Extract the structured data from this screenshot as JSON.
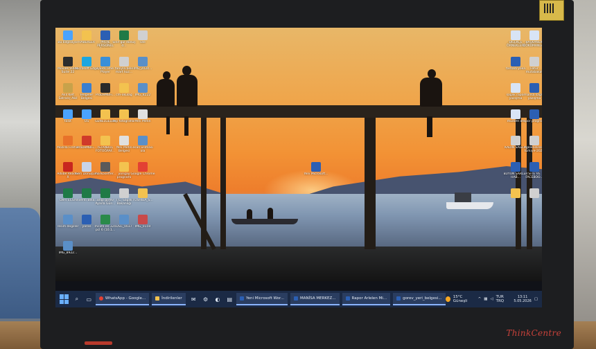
{
  "colors": {
    "taskbar": "#1b2a45",
    "accent": "#8ab4ff",
    "sticker": "#d8b94a",
    "brand_red": "#c8423a"
  },
  "monitor": {
    "brand": "ThinkCentre"
  },
  "desktop": {
    "left_icons": [
      {
        "label": "Bu bilgisayar",
        "icon": "computer-icon",
        "color": "#4aa3ff"
      },
      {
        "label": "HABERLER",
        "icon": "folder-icon",
        "color": "#f3c24f"
      },
      {
        "label": "PROJE PERSONEL Belgesi",
        "icon": "word-doc-icon",
        "color": "#2b5fb3"
      },
      {
        "label": "Sınıf gül dönüş d...",
        "icon": "excel-doc-icon",
        "color": "#1f7a46"
      },
      {
        "label": "İzle",
        "icon": "file-icon",
        "color": "#d0d0d0"
      },
      {
        "label": "Movies Video Suite 22",
        "icon": "video-app-icon",
        "color": "#2d2d2d"
      },
      {
        "label": "Microsoft Edge",
        "icon": "edge-icon",
        "color": "#1da6e0"
      },
      {
        "label": "QuickTime Player",
        "icon": "quicktime-icon",
        "color": "#3a8fd8"
      },
      {
        "label": "tanıyla bele mart kuz...",
        "icon": "file-icon",
        "color": "#d0d0d0"
      },
      {
        "label": "IMG_2024...",
        "icon": "image-icon",
        "color": "#5a8fc8"
      },
      {
        "label": "Akıl Kelt Satranç Akıl",
        "icon": "game-icon",
        "color": "#c8a24a"
      },
      {
        "label": "Belgeler Belgesi",
        "icon": "folder-icon",
        "color": "#3a7fd0"
      },
      {
        "label": "ProDeMBFi...",
        "icon": "app-icon",
        "color": "#2a2a2a"
      },
      {
        "label": "cm-okulag",
        "icon": "folder-icon",
        "color": "#f3c24f"
      },
      {
        "label": "IMG_8222",
        "icon": "image-icon",
        "color": "#5a8fc8"
      },
      {
        "label": "tasit",
        "icon": "file-icon",
        "color": "#4aa3ff"
      },
      {
        "label": "OS",
        "icon": "file-icon",
        "color": "#4aa3ff"
      },
      {
        "label": "GENELGELER",
        "icon": "folder-icon",
        "color": "#f3c24f"
      },
      {
        "label": "tep fotoğraflar",
        "icon": "folder-icon",
        "color": "#f3c24f"
      },
      {
        "label": "Yeni Metin",
        "icon": "text-doc-icon",
        "color": "#e0e0e0"
      },
      {
        "label": "Mozilla Firefox",
        "icon": "firefox-icon",
        "color": "#e8722a"
      },
      {
        "label": "ProDeMBFi...",
        "icon": "app-icon",
        "color": "#d03a2a"
      },
      {
        "label": "İSTANBUL FOTOĞRAF...",
        "icon": "folder-icon",
        "color": "#f3c24f"
      },
      {
        "label": "Yeni Metin Belgesi",
        "icon": "text-doc-icon",
        "color": "#e0e0e0"
      },
      {
        "label": "esan üslmasi ola",
        "icon": "image-icon",
        "color": "#5a8fc8"
      },
      {
        "label": "Adobe Reader X",
        "icon": "pdf-icon",
        "color": "#c8261f"
      },
      {
        "label": "Geri Dönüşüm",
        "icon": "recycle-bin-icon",
        "color": "#c8d4e8"
      },
      {
        "label": "markoseffer...",
        "icon": "image-icon",
        "color": "#5a5a5a"
      },
      {
        "label": "yorigay programı",
        "icon": "folder-icon",
        "color": "#f3c24f"
      },
      {
        "label": "Google Chrome",
        "icon": "chrome-icon",
        "color": "#e34133"
      },
      {
        "label": "Ders ECSA",
        "icon": "excel-doc-icon",
        "color": "#1f7a46"
      },
      {
        "label": "İnventi Bela...",
        "icon": "excel-doc-icon",
        "color": "#1f7a46"
      },
      {
        "label": "Bİlgi görev Ayarla Gün...",
        "icon": "excel-doc-icon",
        "color": "#1f7a46"
      },
      {
        "label": "T.C. Sağlık Bakanlığı",
        "icon": "file-icon",
        "color": "#d0d0d0"
      },
      {
        "label": "TOSHIBA_S...",
        "icon": "folder-icon",
        "color": "#f3c24f"
      },
      {
        "label": "resim değiller",
        "icon": "image-icon",
        "color": "#5a8fc8"
      },
      {
        "label": "yaran",
        "icon": "word-doc-icon",
        "color": "#2b5fb3"
      },
      {
        "label": "mcafe en 320 pcl 6 (10.1...",
        "icon": "app-icon",
        "color": "#2a8a4a"
      },
      {
        "label": "DSC_0037",
        "icon": "image-icon",
        "color": "#5a8fc8"
      },
      {
        "label": "IMG_0159",
        "icon": "image-icon",
        "color": "#c84a4a"
      },
      {
        "label": "IMG_8922...",
        "icon": "image-icon",
        "color": "#5a8fc8"
      }
    ],
    "right_icons": [
      {
        "label": "DİLEKÇE ÖRNEKLERİ",
        "icon": "word-doc-icon",
        "color": "#d8e4f5"
      },
      {
        "label": "BAŞKANLIK DÖKÜMANLAR",
        "icon": "word-doc-icon",
        "color": "#d8e4f5"
      },
      {
        "label": "tamadi yoka",
        "icon": "word-doc-icon",
        "color": "#2b5fb3"
      },
      {
        "label": "Fatur mutabakat",
        "icon": "file-icon",
        "color": "#d0d0d0"
      },
      {
        "label": "sağlık rapor yazışma",
        "icon": "word-doc-icon",
        "color": "#d8e4f5"
      },
      {
        "label": "mansa sağlık yazışma",
        "icon": "word-doc-icon",
        "color": "#2b5fb3"
      },
      {
        "label": "mudafe alt",
        "icon": "word-doc-icon",
        "color": "#d8e4f5"
      },
      {
        "label": "spor program",
        "icon": "word-doc-icon",
        "color": "#2b5fb3"
      },
      {
        "label": "KADIN SAĞLIK",
        "icon": "file-icon",
        "color": "#d0d0d0"
      },
      {
        "label": "geleneksel türkiye-2026",
        "icon": "file-icon",
        "color": "#d0d0d0"
      },
      {
        "label": "BÜYÜN ŞARLER HAB...",
        "icon": "word-doc-icon",
        "color": "#2b5fb3"
      },
      {
        "label": "SİTE VE FACEBOO...",
        "icon": "word-doc-icon",
        "color": "#2b5fb3"
      },
      {
        "label": "",
        "icon": "file-icon",
        "color": "#f3c24f"
      },
      {
        "label": "",
        "icon": "file-icon",
        "color": "#d0d0d0"
      }
    ],
    "center_icon": {
      "label": "Yeni Microsoft...",
      "icon": "word-doc-icon",
      "color": "#2b5fb3"
    }
  },
  "taskbar": {
    "apps": [
      {
        "label": "WhatsApp - Google...",
        "icon": "chrome-icon",
        "color": "#e34133"
      },
      {
        "label": "İndirilenler",
        "icon": "folder-icon",
        "color": "#f3c24f"
      },
      {
        "label": "Yeni Microsoft Wor...",
        "icon": "word-icon",
        "color": "#2b5fb3"
      },
      {
        "label": "MANİSA MERKEZ...",
        "icon": "word-icon",
        "color": "#2b5fb3"
      },
      {
        "label": "Rapor Arlelen Mi...",
        "icon": "word-icon",
        "color": "#2b5fb3"
      },
      {
        "label": "gorev_yeri_belgesi...",
        "icon": "word-icon",
        "color": "#2b5fb3"
      }
    ],
    "weather": "15°C Güneşli",
    "language": "TUR TRQ",
    "time": "13:11",
    "date": "5.05.2026"
  }
}
